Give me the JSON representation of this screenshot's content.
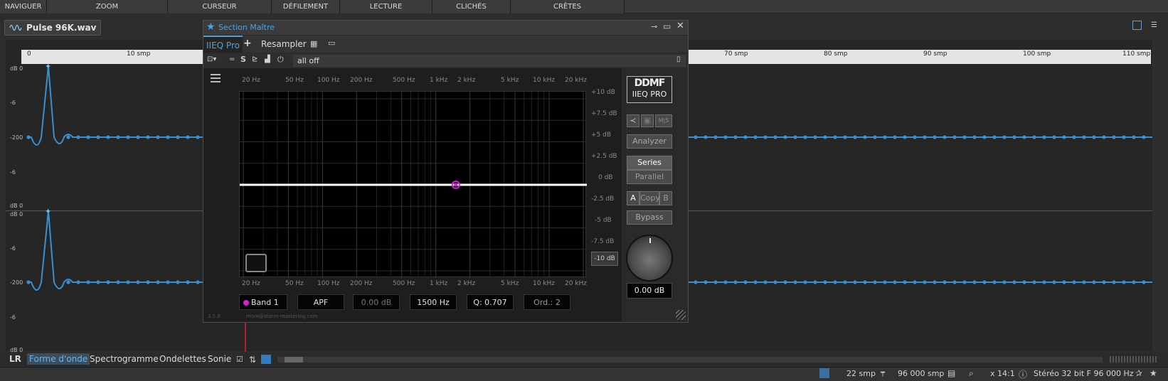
{
  "top_menu": [
    "NAVIGUER",
    "ZOOM",
    "CURSEUR",
    "DÉFILEMENT",
    "LECTURE",
    "CLICHÉS",
    "CRÊTES"
  ],
  "file_tab": {
    "name": "Pulse 96K.wav"
  },
  "ruler": {
    "labels": [
      "0",
      "10 smp",
      "70 smp",
      "80 smp",
      "90 smp",
      "100 smp",
      "110 smp"
    ]
  },
  "waveform": {
    "db_labels_ch1": [
      "dB 0",
      "-6",
      "-200",
      "-6"
    ],
    "db_labels_ch2": [
      "dB 0",
      "dB 0",
      "-6",
      "-200",
      "-6",
      "dB 0"
    ],
    "color": "#3a8fd0"
  },
  "view_tabs": {
    "lr": "LR",
    "items": [
      "Forme d'onde",
      "Spectrogramme",
      "Ondelettes",
      "Sonie"
    ],
    "active": "Forme d'onde"
  },
  "status_bar": {
    "cursor": "22 smp",
    "length": "96 000 smp",
    "zoom": "x 14:1",
    "format": "Stéréo 32 bit F 96 000 Hz"
  },
  "plugin": {
    "title": "Section Maître",
    "tabs": [
      "IIEQ Pro",
      "+",
      "Resampler"
    ],
    "active_tab": "IIEQ Pro",
    "preset": "all off",
    "freq_labels": [
      "20 Hz",
      "50 Hz",
      "100 Hz",
      "200 Hz",
      "500 Hz",
      "1 kHz",
      "2 kHz",
      "5 kHz",
      "10 kHz",
      "20 kHz"
    ],
    "db_labels": [
      "+10 dB",
      "+7.5 dB",
      "+5 dB",
      "+2.5 dB",
      "0 dB",
      "-2.5 dB",
      "-5 dB",
      "-7.5 dB",
      "-10 dB"
    ],
    "logo_top": "DDMF",
    "logo_bottom": "IIEQ PRO",
    "ms_label": "M|S",
    "buttons": {
      "analyzer": "Analyzer",
      "series": "Series",
      "parallel": "Parallel",
      "a": "A",
      "copy": "Copy",
      "b": "B",
      "bypass": "Bypass"
    },
    "output_gain": "0.00 dB",
    "band": {
      "name": "Band 1",
      "type": "APF",
      "gain": "0.00 dB",
      "freq": "1500 Hz",
      "q": "Q: 0.707",
      "order": "Ord.: 2",
      "color": "#d020d0",
      "frequency_hz": 1500,
      "gain_db": 0
    },
    "version": "3.5.8",
    "email": "more@storm-mastering.com",
    "accent": "#4aa3e0"
  }
}
